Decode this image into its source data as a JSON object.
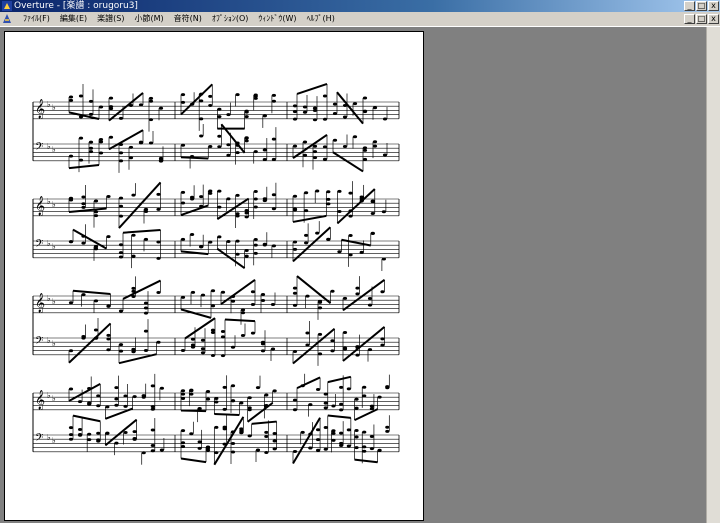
{
  "window": {
    "title": "Overture - [楽譜 : orugoru3]",
    "controls": [
      "_",
      "□",
      "x"
    ]
  },
  "menu": {
    "items": [
      "ﾌｧｲﾙ(F)",
      "編集(E)",
      "楽譜(S)",
      "小節(M)",
      "音符(N)",
      "ｵﾌﾟｼｮﾝ(O)",
      "ｳｨﾝﾄﾞｳ(W)",
      "ﾍﾙﾌﾟ(H)"
    ]
  },
  "doc_controls": [
    "_",
    "□",
    "x"
  ],
  "score": {
    "key_signature": "flat x2",
    "clefs": [
      "treble",
      "bass"
    ],
    "systems": 4,
    "measures_per_system": 3
  }
}
